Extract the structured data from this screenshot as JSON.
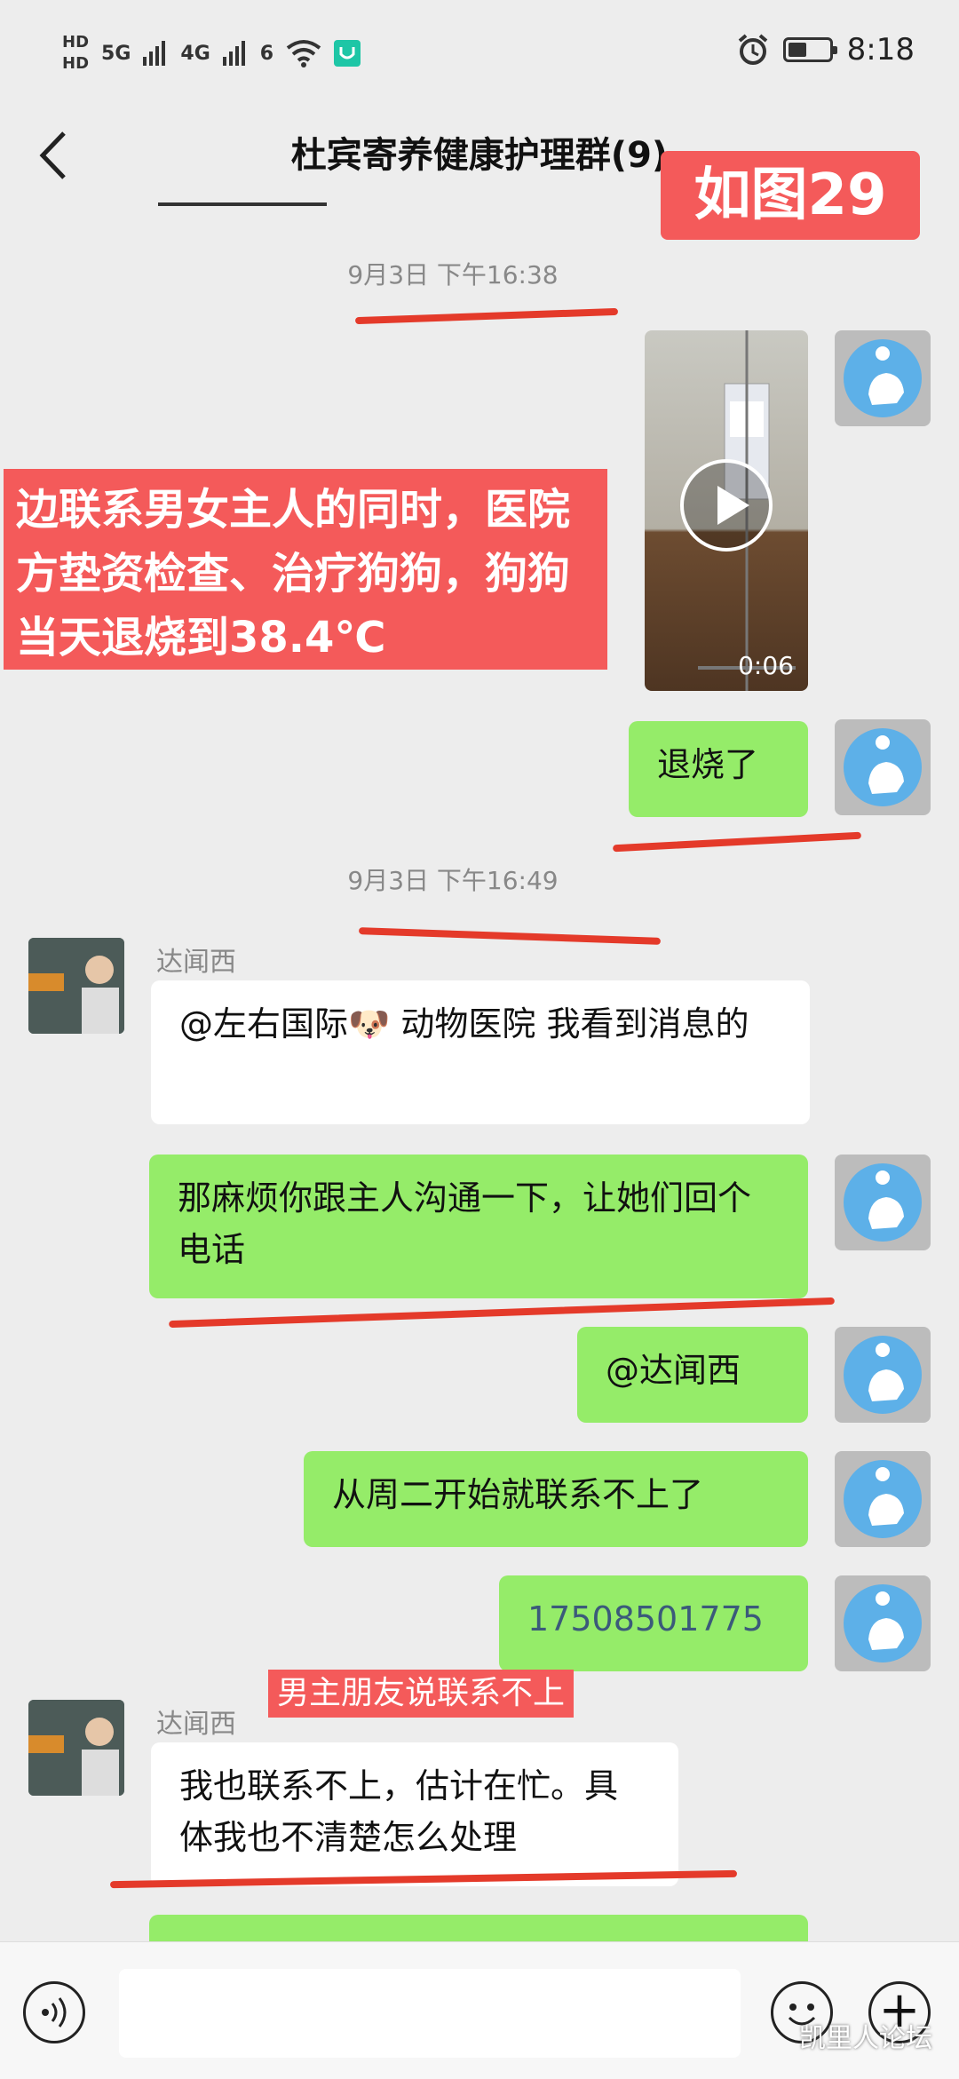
{
  "status_bar": {
    "hd1": "HD",
    "hd2": "HD",
    "signal1": "5G",
    "signal2": "4G",
    "wifi_tag": "6",
    "time": "8:18"
  },
  "header": {
    "title": "杜宾寄养健康护理群(9)",
    "more": "···",
    "annotation": "如图29"
  },
  "messages": {
    "ts1": "9月3日 下午16:38",
    "video_duration": "0:06",
    "annotation_big": "边联系男女主人的同时，医院方垫资检查、治疗狗狗，狗狗当天退烧到38.4℃",
    "msg_fever": "退烧了",
    "ts2": "9月3日 下午16:49",
    "sender1": "达闻西",
    "msg_hospital": "@左右国际🐶 动物医院  我看到消息的",
    "msg_contact": "那麻烦你跟主人沟通一下，让她们回个电话",
    "msg_at": "@达闻西",
    "msg_tuesday": "从周二开始就联系不上了",
    "msg_phone": "17508501775",
    "annotation_small": "男主朋友说联系不上",
    "sender2": "达闻西",
    "msg_unknown": "我也联系不上，估计在忙。具体我也不清楚怎么处理"
  },
  "footer": {
    "watermark": "凯里人论坛",
    "plus": "+"
  },
  "colors": {
    "green_bubble": "#95ec69",
    "annotation_red": "#f45a5a",
    "scribble_red": "#e43a2a",
    "avatar_blue": "#5db0e8"
  },
  "icons": [
    "back-arrow-icon",
    "more-icon",
    "play-icon",
    "voice-icon",
    "emoji-icon",
    "plus-icon",
    "battery-icon",
    "alarm-icon",
    "wifi-icon"
  ]
}
